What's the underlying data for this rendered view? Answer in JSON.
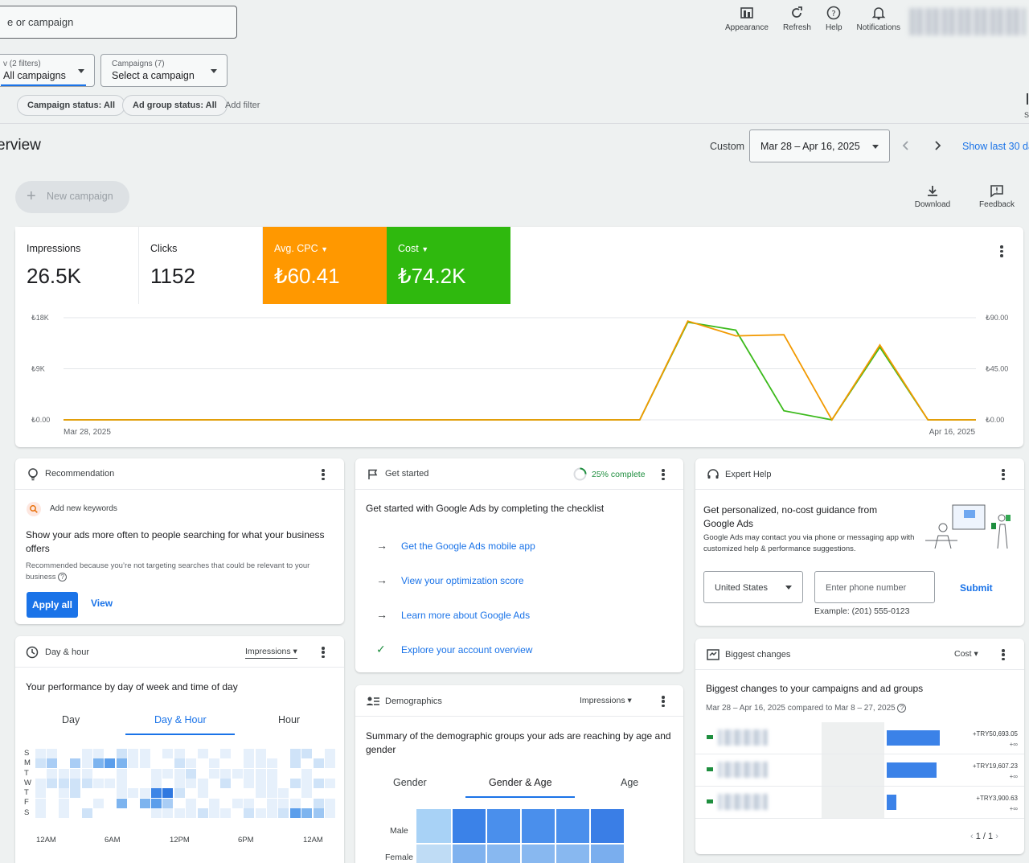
{
  "header": {
    "search_text": "e or campaign",
    "actions": [
      {
        "label": "Appearance",
        "icon": "appearance-icon"
      },
      {
        "label": "Refresh",
        "icon": "refresh-icon"
      },
      {
        "label": "Help",
        "icon": "help-icon"
      },
      {
        "label": "Notifications",
        "icon": "bell-icon"
      }
    ]
  },
  "filters": {
    "view": {
      "label": "v (2 filters)",
      "value": "All campaigns"
    },
    "campaigns": {
      "label": "Campaigns (7)",
      "value": "Select a campaign"
    },
    "chips": [
      "Campaign status: All",
      "Ad group status: All"
    ],
    "add_filter": "Add filter",
    "edge_char": "S"
  },
  "page": {
    "title": "erview",
    "date_mode": "Custom",
    "date_range": "Mar 28 – Apr 16, 2025",
    "show_last": "Show last 30 da",
    "new_campaign": "New campaign",
    "download": "Download",
    "feedback": "Feedback"
  },
  "metrics": [
    {
      "label": "Impressions",
      "value": "26.5K",
      "bg": "#ffffff",
      "fg": "#202124"
    },
    {
      "label": "Clicks",
      "value": "1152",
      "bg": "#ffffff",
      "fg": "#202124"
    },
    {
      "label": "Avg. CPC",
      "value": "₺60.41",
      "bg": "#ff9800",
      "fg": "#ffffff"
    },
    {
      "label": "Cost",
      "value": "₺74.2K",
      "bg": "#2fb90e",
      "fg": "#ffffff"
    }
  ],
  "chart_data": {
    "type": "line",
    "x_start": "Mar 28, 2025",
    "x_end": "Apr 16, 2025",
    "left_ticks": [
      "₺18K",
      "₺9K",
      "₺0.00"
    ],
    "right_ticks": [
      "₺90.00",
      "₺45.00",
      "₺0.00"
    ],
    "ylim_left": [
      0,
      18000
    ],
    "ylim_right": [
      0,
      90
    ],
    "days": 20,
    "series": [
      {
        "color": "#f29900",
        "axis": "right",
        "values": [
          0,
          0,
          0,
          0,
          0,
          0,
          0,
          0,
          0,
          0,
          0,
          0,
          0,
          0,
          0,
          0,
          0,
          0,
          0,
          0,
          0,
          0,
          0,
          0,
          0,
          0,
          0,
          0,
          0,
          0,
          0,
          0,
          0,
          0,
          0,
          0,
          0,
          0,
          0,
          0,
          0,
          0,
          0,
          0,
          0,
          0,
          0,
          0,
          0,
          0,
          0,
          0,
          0,
          0,
          0,
          0,
          0,
          0,
          0,
          0,
          0,
          0,
          0,
          0,
          0,
          0,
          0,
          0,
          0,
          0,
          0,
          0,
          0,
          0,
          0,
          0,
          0,
          0,
          0,
          0,
          0,
          0,
          0,
          0,
          0,
          0,
          0,
          0,
          0,
          0
        ]
      },
      {
        "color": "#3cba1c",
        "axis": "left",
        "values": [
          0,
          0,
          0,
          0,
          0,
          0,
          0,
          0,
          0,
          0,
          0,
          0,
          0,
          0,
          0,
          0,
          0,
          0,
          0,
          0,
          0,
          0,
          0,
          0,
          0,
          0,
          0,
          0,
          0,
          0,
          0,
          0,
          0,
          0,
          0,
          0,
          0,
          0,
          0,
          0,
          0,
          0,
          0,
          0,
          0,
          0,
          0,
          0,
          0,
          0,
          0,
          0,
          0,
          0,
          0,
          0,
          0,
          0,
          0,
          0,
          0,
          0,
          0,
          0,
          0,
          0,
          0,
          0,
          0,
          0,
          0,
          0,
          0,
          0,
          0,
          0,
          0,
          0,
          0,
          0,
          0,
          0,
          0,
          0,
          0,
          0,
          0,
          0,
          0,
          0
        ]
      }
    ],
    "points_orange": [
      [
        0,
        0
      ],
      [
        12,
        0
      ],
      [
        13,
        87
      ],
      [
        14,
        74
      ],
      [
        15,
        75
      ],
      [
        16,
        0
      ],
      [
        17,
        66
      ],
      [
        18,
        0
      ],
      [
        19,
        0
      ]
    ],
    "points_green": [
      [
        0,
        0
      ],
      [
        12,
        0
      ],
      [
        13,
        86
      ],
      [
        14,
        79
      ],
      [
        15,
        8
      ],
      [
        16,
        0
      ],
      [
        17,
        64
      ],
      [
        18,
        0
      ],
      [
        19,
        0
      ]
    ]
  },
  "recommendation": {
    "header": "Recommendation",
    "tag": "Add new keywords",
    "headline": "Show your ads more often to people searching for what your business offers",
    "detail": "Recommended because you’re not targeting searches that could be relevant to your business",
    "apply": "Apply all",
    "view": "View"
  },
  "get_started": {
    "header": "Get started",
    "progress": "25% complete",
    "intro": "Get started with Google Ads by completing the checklist",
    "items": [
      {
        "label": "Get the Google Ads mobile app",
        "done": false
      },
      {
        "label": "View your optimization score",
        "done": false
      },
      {
        "label": "Learn more about Google Ads",
        "done": false
      },
      {
        "label": "Explore your account overview",
        "done": true
      }
    ]
  },
  "expert": {
    "header": "Expert Help",
    "headline": "Get personalized, no-cost guidance from Google Ads",
    "detail": "Google Ads may contact you via phone or messaging app with customized help & performance suggestions.",
    "country": "United States",
    "phone_placeholder": "Enter phone number",
    "submit": "Submit",
    "example": "Example: (201) 555-0123"
  },
  "day_hour": {
    "header": "Day & hour",
    "metric": "Impressions",
    "intro": "Your performance by day of week and time of day",
    "tabs": [
      "Day",
      "Day & Hour",
      "Hour"
    ],
    "days": [
      "S",
      "M",
      "T",
      "W",
      "T",
      "F",
      "S"
    ],
    "hours": [
      "12AM",
      "6AM",
      "12PM",
      "6PM",
      "12AM"
    ]
  },
  "demographics": {
    "header": "Demographics",
    "metric": "Impressions",
    "intro": "Summary of the demographic groups your ads are reaching by age and gender",
    "tabs": [
      "Gender",
      "Gender & Age",
      "Age"
    ],
    "rows": [
      "Male",
      "Female"
    ]
  },
  "biggest_changes": {
    "header": "Biggest changes",
    "metric": "Cost",
    "intro": "Biggest changes to your campaigns and ad groups",
    "compare": "Mar 28 – Apr 16, 2025 compared to Mar 8 – 27, 2025",
    "rows": [
      {
        "value": "+TRY50,693.05",
        "pct": "+∞",
        "fraction": 1.0
      },
      {
        "value": "+TRY19,607.23",
        "pct": "+∞",
        "fraction": 0.94
      },
      {
        "value": "+TRY3,900.63",
        "pct": "+∞",
        "fraction": 0.18
      }
    ],
    "pager": "1 / 1"
  }
}
